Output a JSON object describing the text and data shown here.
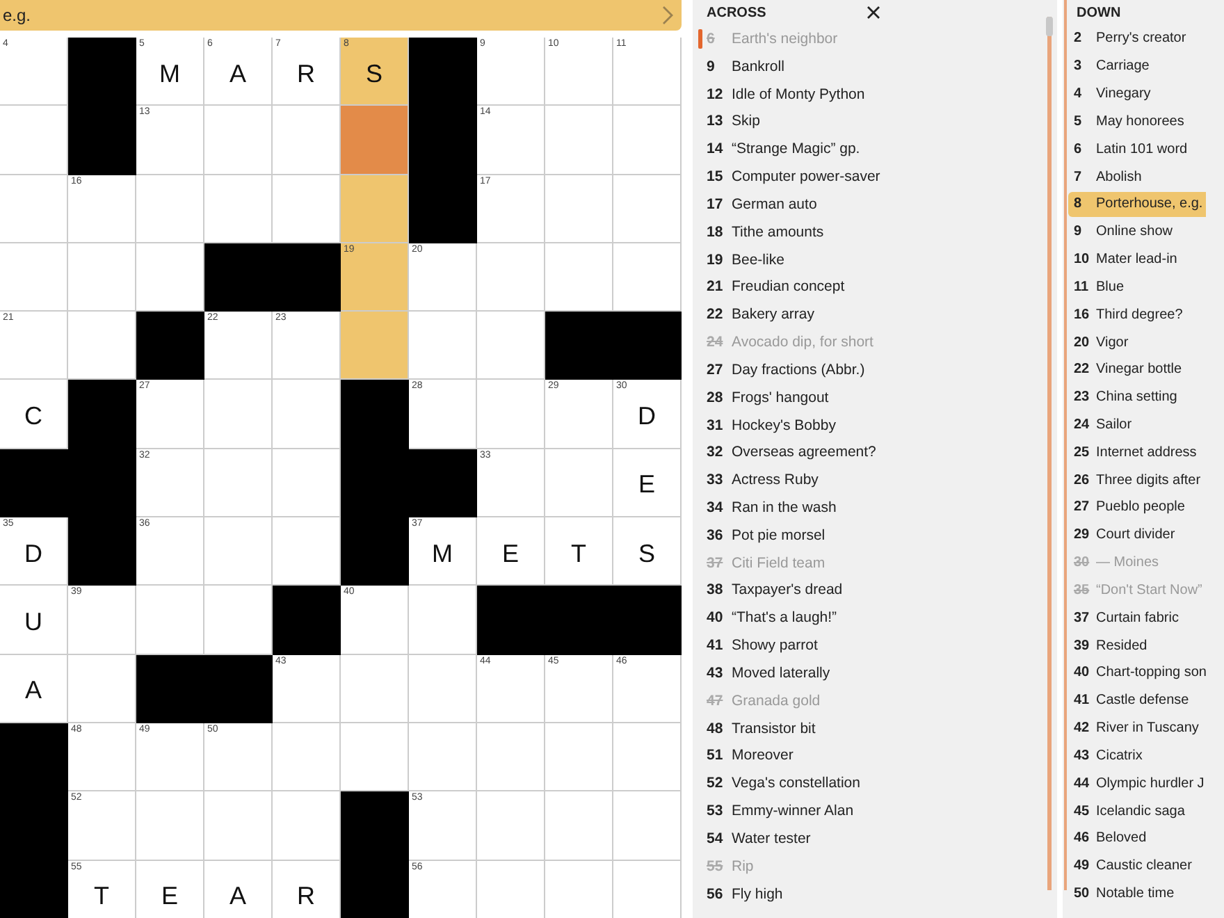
{
  "banner": {
    "text": "e.g."
  },
  "grid": {
    "rows": [
      [
        {
          "kind": "square",
          "number": "4",
          "in_word": false,
          "active": false
        },
        {
          "kind": "block"
        },
        {
          "kind": "square",
          "number": "5",
          "letter": "M",
          "in_word": false,
          "active": false
        },
        {
          "kind": "square",
          "number": "6",
          "letter": "A",
          "in_word": false,
          "active": false
        },
        {
          "kind": "square",
          "number": "7",
          "letter": "R",
          "in_word": false,
          "active": false
        },
        {
          "kind": "square",
          "number": "8",
          "letter": "S",
          "in_word": true,
          "active": false
        },
        {
          "kind": "block"
        },
        {
          "kind": "square",
          "number": "9",
          "in_word": false,
          "active": false
        },
        {
          "kind": "square",
          "number": "10",
          "in_word": false,
          "active": false
        },
        {
          "kind": "square",
          "number": "11",
          "in_word": false,
          "active": false
        }
      ],
      [
        {
          "kind": "square",
          "in_word": false,
          "active": false
        },
        {
          "kind": "block"
        },
        {
          "kind": "square",
          "number": "13",
          "in_word": false,
          "active": false
        },
        {
          "kind": "square",
          "in_word": false,
          "active": false
        },
        {
          "kind": "square",
          "in_word": false,
          "active": false
        },
        {
          "kind": "square",
          "in_word": true,
          "active": true
        },
        {
          "kind": "block"
        },
        {
          "kind": "square",
          "number": "14",
          "in_word": false,
          "active": false
        },
        {
          "kind": "square",
          "in_word": false,
          "active": false
        },
        {
          "kind": "square",
          "in_word": false,
          "active": false
        }
      ],
      [
        {
          "kind": "square",
          "in_word": false,
          "active": false
        },
        {
          "kind": "square",
          "number": "16",
          "in_word": false,
          "active": false
        },
        {
          "kind": "square",
          "in_word": false,
          "active": false
        },
        {
          "kind": "square",
          "in_word": false,
          "active": false
        },
        {
          "kind": "square",
          "in_word": false,
          "active": false
        },
        {
          "kind": "square",
          "in_word": true,
          "active": false
        },
        {
          "kind": "block"
        },
        {
          "kind": "square",
          "number": "17",
          "in_word": false,
          "active": false
        },
        {
          "kind": "square",
          "in_word": false,
          "active": false
        },
        {
          "kind": "square",
          "in_word": false,
          "active": false
        }
      ],
      [
        {
          "kind": "square",
          "in_word": false,
          "active": false
        },
        {
          "kind": "square",
          "in_word": false,
          "active": false
        },
        {
          "kind": "square",
          "in_word": false,
          "active": false
        },
        {
          "kind": "block"
        },
        {
          "kind": "block"
        },
        {
          "kind": "square",
          "number": "19",
          "in_word": true,
          "active": false
        },
        {
          "kind": "square",
          "number": "20",
          "in_word": false,
          "active": false
        },
        {
          "kind": "square",
          "in_word": false,
          "active": false
        },
        {
          "kind": "square",
          "in_word": false,
          "active": false
        },
        {
          "kind": "square",
          "in_word": false,
          "active": false
        }
      ],
      [
        {
          "kind": "square",
          "number": "21",
          "in_word": false,
          "active": false
        },
        {
          "kind": "square",
          "in_word": false,
          "active": false
        },
        {
          "kind": "block"
        },
        {
          "kind": "square",
          "number": "22",
          "in_word": false,
          "active": false
        },
        {
          "kind": "square",
          "number": "23",
          "in_word": false,
          "active": false
        },
        {
          "kind": "square",
          "in_word": true,
          "active": false
        },
        {
          "kind": "square",
          "in_word": false,
          "active": false
        },
        {
          "kind": "square",
          "in_word": false,
          "active": false
        },
        {
          "kind": "block"
        },
        {
          "kind": "block"
        }
      ],
      [
        {
          "kind": "square",
          "letter": "C",
          "in_word": false,
          "active": false
        },
        {
          "kind": "block"
        },
        {
          "kind": "square",
          "number": "27",
          "in_word": false,
          "active": false
        },
        {
          "kind": "square",
          "in_word": false,
          "active": false
        },
        {
          "kind": "square",
          "in_word": false,
          "active": false
        },
        {
          "kind": "block"
        },
        {
          "kind": "square",
          "number": "28",
          "in_word": false,
          "active": false
        },
        {
          "kind": "square",
          "in_word": false,
          "active": false
        },
        {
          "kind": "square",
          "number": "29",
          "in_word": false,
          "active": false
        },
        {
          "kind": "square",
          "number": "30",
          "letter": "D",
          "in_word": false,
          "active": false
        }
      ],
      [
        {
          "kind": "block"
        },
        {
          "kind": "block"
        },
        {
          "kind": "square",
          "number": "32",
          "in_word": false,
          "active": false
        },
        {
          "kind": "square",
          "in_word": false,
          "active": false
        },
        {
          "kind": "square",
          "in_word": false,
          "active": false
        },
        {
          "kind": "block"
        },
        {
          "kind": "block"
        },
        {
          "kind": "square",
          "number": "33",
          "in_word": false,
          "active": false
        },
        {
          "kind": "square",
          "in_word": false,
          "active": false
        },
        {
          "kind": "square",
          "letter": "E",
          "in_word": false,
          "active": false
        }
      ],
      [
        {
          "kind": "square",
          "number": "35",
          "letter": "D",
          "in_word": false,
          "active": false
        },
        {
          "kind": "block"
        },
        {
          "kind": "square",
          "number": "36",
          "in_word": false,
          "active": false
        },
        {
          "kind": "square",
          "in_word": false,
          "active": false
        },
        {
          "kind": "square",
          "in_word": false,
          "active": false
        },
        {
          "kind": "block"
        },
        {
          "kind": "square",
          "number": "37",
          "letter": "M",
          "in_word": false,
          "active": false
        },
        {
          "kind": "square",
          "letter": "E",
          "in_word": false,
          "active": false
        },
        {
          "kind": "square",
          "letter": "T",
          "in_word": false,
          "active": false
        },
        {
          "kind": "square",
          "letter": "S",
          "in_word": false,
          "active": false
        }
      ],
      [
        {
          "kind": "square",
          "letter": "U",
          "in_word": false,
          "active": false
        },
        {
          "kind": "square",
          "number": "39",
          "in_word": false,
          "active": false
        },
        {
          "kind": "square",
          "in_word": false,
          "active": false
        },
        {
          "kind": "square",
          "in_word": false,
          "active": false
        },
        {
          "kind": "block"
        },
        {
          "kind": "square",
          "number": "40",
          "in_word": false,
          "active": false
        },
        {
          "kind": "square",
          "in_word": false,
          "active": false
        },
        {
          "kind": "block"
        },
        {
          "kind": "block"
        },
        {
          "kind": "block"
        }
      ],
      [
        {
          "kind": "square",
          "letter": "A",
          "in_word": false,
          "active": false
        },
        {
          "kind": "square",
          "in_word": false,
          "active": false
        },
        {
          "kind": "block"
        },
        {
          "kind": "block"
        },
        {
          "kind": "square",
          "number": "43",
          "in_word": false,
          "active": false
        },
        {
          "kind": "square",
          "in_word": false,
          "active": false
        },
        {
          "kind": "square",
          "in_word": false,
          "active": false
        },
        {
          "kind": "square",
          "number": "44",
          "in_word": false,
          "active": false
        },
        {
          "kind": "square",
          "number": "45",
          "in_word": false,
          "active": false
        },
        {
          "kind": "square",
          "number": "46",
          "in_word": false,
          "active": false
        }
      ],
      [
        {
          "kind": "block"
        },
        {
          "kind": "square",
          "number": "48",
          "in_word": false,
          "active": false
        },
        {
          "kind": "square",
          "number": "49",
          "in_word": false,
          "active": false
        },
        {
          "kind": "square",
          "number": "50",
          "in_word": false,
          "active": false
        },
        {
          "kind": "square",
          "in_word": false,
          "active": false
        },
        {
          "kind": "square",
          "in_word": false,
          "active": false
        },
        {
          "kind": "square",
          "in_word": false,
          "active": false
        },
        {
          "kind": "square",
          "in_word": false,
          "active": false
        },
        {
          "kind": "square",
          "in_word": false,
          "active": false
        },
        {
          "kind": "square",
          "in_word": false,
          "active": false
        }
      ],
      [
        {
          "kind": "block"
        },
        {
          "kind": "square",
          "number": "52",
          "in_word": false,
          "active": false
        },
        {
          "kind": "square",
          "in_word": false,
          "active": false
        },
        {
          "kind": "square",
          "in_word": false,
          "active": false
        },
        {
          "kind": "square",
          "in_word": false,
          "active": false
        },
        {
          "kind": "block"
        },
        {
          "kind": "square",
          "number": "53",
          "in_word": false,
          "active": false
        },
        {
          "kind": "square",
          "in_word": false,
          "active": false
        },
        {
          "kind": "square",
          "in_word": false,
          "active": false
        },
        {
          "kind": "square",
          "in_word": false,
          "active": false
        }
      ],
      [
        {
          "kind": "block"
        },
        {
          "kind": "square",
          "number": "55",
          "letter": "T",
          "in_word": false,
          "active": false
        },
        {
          "kind": "square",
          "letter": "E",
          "in_word": false,
          "active": false
        },
        {
          "kind": "square",
          "letter": "A",
          "in_word": false,
          "active": false
        },
        {
          "kind": "square",
          "letter": "R",
          "in_word": false,
          "active": false
        },
        {
          "kind": "block"
        },
        {
          "kind": "square",
          "number": "56",
          "in_word": false,
          "active": false
        },
        {
          "kind": "square",
          "in_word": false,
          "active": false
        },
        {
          "kind": "square",
          "in_word": false,
          "active": false
        },
        {
          "kind": "square",
          "in_word": false,
          "active": false
        }
      ]
    ]
  },
  "across": {
    "title": "ACROSS",
    "clues": [
      {
        "number": "6",
        "text": "Earth's neighbor",
        "done": true,
        "current": true,
        "selected": false
      },
      {
        "number": "9",
        "text": "Bankroll",
        "done": false,
        "current": false,
        "selected": false
      },
      {
        "number": "12",
        "text": "Idle of Monty Python",
        "done": false,
        "current": false,
        "selected": false
      },
      {
        "number": "13",
        "text": "Skip",
        "done": false,
        "current": false,
        "selected": false
      },
      {
        "number": "14",
        "text": "“Strange Magic” gp.",
        "done": false,
        "current": false,
        "selected": false
      },
      {
        "number": "15",
        "text": "Computer power-saver",
        "done": false,
        "current": false,
        "selected": false
      },
      {
        "number": "17",
        "text": "German auto",
        "done": false,
        "current": false,
        "selected": false
      },
      {
        "number": "18",
        "text": "Tithe amounts",
        "done": false,
        "current": false,
        "selected": false
      },
      {
        "number": "19",
        "text": "Bee-like",
        "done": false,
        "current": false,
        "selected": false
      },
      {
        "number": "21",
        "text": "Freudian concept",
        "done": false,
        "current": false,
        "selected": false
      },
      {
        "number": "22",
        "text": "Bakery array",
        "done": false,
        "current": false,
        "selected": false
      },
      {
        "number": "24",
        "text": "Avocado dip, for short",
        "done": true,
        "current": false,
        "selected": false
      },
      {
        "number": "27",
        "text": "Day fractions (Abbr.)",
        "done": false,
        "current": false,
        "selected": false
      },
      {
        "number": "28",
        "text": "Frogs' hangout",
        "done": false,
        "current": false,
        "selected": false
      },
      {
        "number": "31",
        "text": "Hockey's Bobby",
        "done": false,
        "current": false,
        "selected": false
      },
      {
        "number": "32",
        "text": "Overseas agreement?",
        "done": false,
        "current": false,
        "selected": false
      },
      {
        "number": "33",
        "text": "Actress Ruby",
        "done": false,
        "current": false,
        "selected": false
      },
      {
        "number": "34",
        "text": "Ran in the wash",
        "done": false,
        "current": false,
        "selected": false
      },
      {
        "number": "36",
        "text": "Pot pie morsel",
        "done": false,
        "current": false,
        "selected": false
      },
      {
        "number": "37",
        "text": "Citi Field team",
        "done": true,
        "current": false,
        "selected": false
      },
      {
        "number": "38",
        "text": "Taxpayer's dread",
        "done": false,
        "current": false,
        "selected": false
      },
      {
        "number": "40",
        "text": "“That's a laugh!”",
        "done": false,
        "current": false,
        "selected": false
      },
      {
        "number": "41",
        "text": "Showy parrot",
        "done": false,
        "current": false,
        "selected": false
      },
      {
        "number": "43",
        "text": "Moved laterally",
        "done": false,
        "current": false,
        "selected": false
      },
      {
        "number": "47",
        "text": "Granada gold",
        "done": true,
        "current": false,
        "selected": false
      },
      {
        "number": "48",
        "text": "Transistor bit",
        "done": false,
        "current": false,
        "selected": false
      },
      {
        "number": "51",
        "text": "Moreover",
        "done": false,
        "current": false,
        "selected": false
      },
      {
        "number": "52",
        "text": "Vega's constellation",
        "done": false,
        "current": false,
        "selected": false
      },
      {
        "number": "53",
        "text": "Emmy-winner Alan",
        "done": false,
        "current": false,
        "selected": false
      },
      {
        "number": "54",
        "text": "Water tester",
        "done": false,
        "current": false,
        "selected": false
      },
      {
        "number": "55",
        "text": "Rip",
        "done": true,
        "current": false,
        "selected": false
      },
      {
        "number": "56",
        "text": "Fly high",
        "done": false,
        "current": false,
        "selected": false
      }
    ]
  },
  "down": {
    "title": "DOWN",
    "clues": [
      {
        "number": "2",
        "text": "Perry's creator",
        "done": false,
        "current": false,
        "selected": false
      },
      {
        "number": "3",
        "text": "Carriage",
        "done": false,
        "current": false,
        "selected": false
      },
      {
        "number": "4",
        "text": "Vinegary",
        "done": false,
        "current": false,
        "selected": false
      },
      {
        "number": "5",
        "text": "May honorees",
        "done": false,
        "current": false,
        "selected": false
      },
      {
        "number": "6",
        "text": "Latin 101 word",
        "done": false,
        "current": false,
        "selected": false
      },
      {
        "number": "7",
        "text": "Abolish",
        "done": false,
        "current": false,
        "selected": false
      },
      {
        "number": "8",
        "text": "Porterhouse, e.g.",
        "done": false,
        "current": false,
        "selected": true
      },
      {
        "number": "9",
        "text": "Online show",
        "done": false,
        "current": false,
        "selected": false
      },
      {
        "number": "10",
        "text": "Mater lead-in",
        "done": false,
        "current": false,
        "selected": false
      },
      {
        "number": "11",
        "text": "Blue",
        "done": false,
        "current": false,
        "selected": false
      },
      {
        "number": "16",
        "text": "Third degree?",
        "done": false,
        "current": false,
        "selected": false
      },
      {
        "number": "20",
        "text": "Vigor",
        "done": false,
        "current": false,
        "selected": false
      },
      {
        "number": "22",
        "text": "Vinegar bottle",
        "done": false,
        "current": false,
        "selected": false
      },
      {
        "number": "23",
        "text": "China setting",
        "done": false,
        "current": false,
        "selected": false
      },
      {
        "number": "24",
        "text": "Sailor",
        "done": false,
        "current": false,
        "selected": false
      },
      {
        "number": "25",
        "text": "Internet address",
        "done": false,
        "current": false,
        "selected": false
      },
      {
        "number": "26",
        "text": "Three digits after",
        "done": false,
        "current": false,
        "selected": false
      },
      {
        "number": "27",
        "text": "Pueblo people",
        "done": false,
        "current": false,
        "selected": false
      },
      {
        "number": "29",
        "text": "Court divider",
        "done": false,
        "current": false,
        "selected": false
      },
      {
        "number": "30",
        "text": "— Moines",
        "done": true,
        "current": false,
        "selected": false
      },
      {
        "number": "35",
        "text": "“Don't Start Now”",
        "done": true,
        "current": false,
        "selected": false
      },
      {
        "number": "37",
        "text": "Curtain fabric",
        "done": false,
        "current": false,
        "selected": false
      },
      {
        "number": "39",
        "text": "Resided",
        "done": false,
        "current": false,
        "selected": false
      },
      {
        "number": "40",
        "text": "Chart-topping son",
        "done": false,
        "current": false,
        "selected": false
      },
      {
        "number": "41",
        "text": "Castle defense",
        "done": false,
        "current": false,
        "selected": false
      },
      {
        "number": "42",
        "text": "River in Tuscany",
        "done": false,
        "current": false,
        "selected": false
      },
      {
        "number": "43",
        "text": "Cicatrix",
        "done": false,
        "current": false,
        "selected": false
      },
      {
        "number": "44",
        "text": "Olympic hurdler J",
        "done": false,
        "current": false,
        "selected": false
      },
      {
        "number": "45",
        "text": "Icelandic saga",
        "done": false,
        "current": false,
        "selected": false
      },
      {
        "number": "46",
        "text": "Beloved",
        "done": false,
        "current": false,
        "selected": false
      },
      {
        "number": "49",
        "text": "Caustic cleaner",
        "done": false,
        "current": false,
        "selected": false
      },
      {
        "number": "50",
        "text": "Notable time",
        "done": false,
        "current": false,
        "selected": false
      }
    ]
  }
}
